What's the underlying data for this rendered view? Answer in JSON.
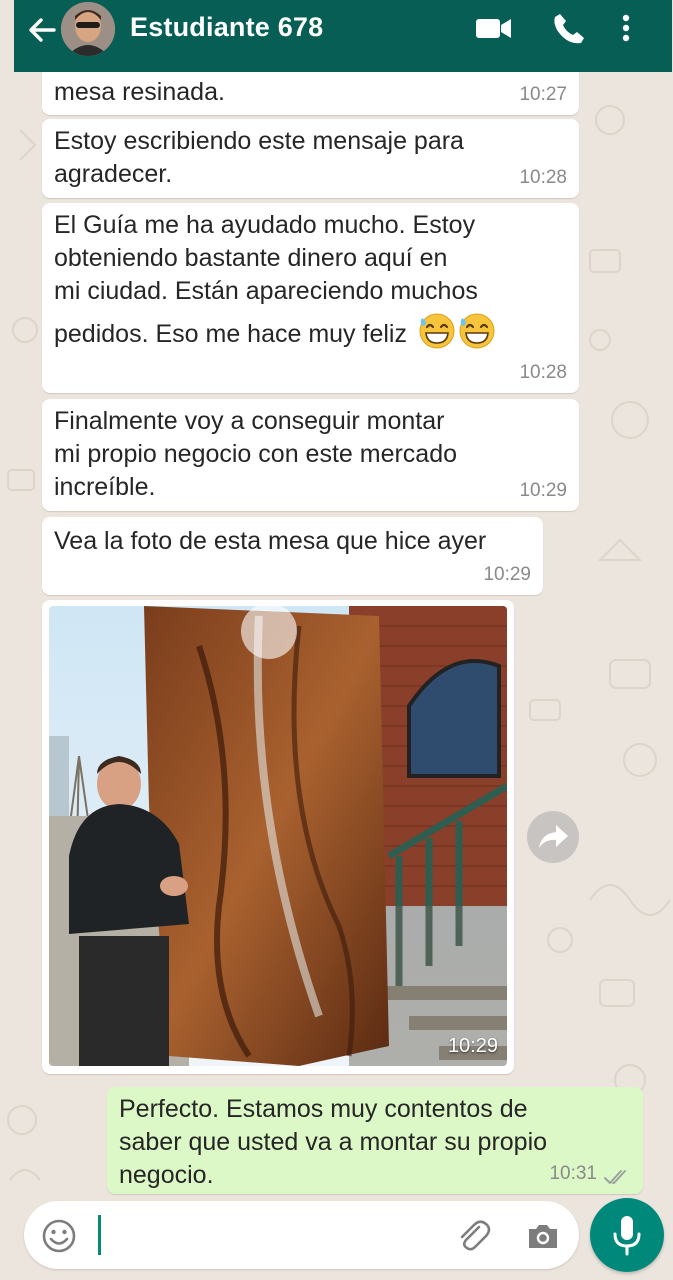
{
  "header": {
    "contact_name": "Estudiante 678",
    "icons": [
      "back-arrow-icon",
      "avatar",
      "video-call-icon",
      "phone-icon",
      "more-vert-icon"
    ]
  },
  "messages": [
    {
      "text": "mesa resinada.",
      "time": "10:27"
    },
    {
      "text": "Estoy escribiendo este mensaje para\nagradecer.",
      "time": "10:28"
    },
    {
      "lines": [
        "El Guía me ha ayudado mucho. Estoy",
        "obteniendo bastante dinero aquí en",
        "mi ciudad. Están apareciendo muchos",
        "pedidos. Eso me hace muy feliz"
      ],
      "emoji": [
        "grinning-sweat-emoji",
        "grinning-sweat-emoji"
      ],
      "time": "10:28"
    },
    {
      "text": "Finalmente voy a conseguir montar\nmi propio negocio con este mercado\nincreíble.",
      "time": "10:29"
    },
    {
      "text": "Vea la foto de esta mesa que hice ayer",
      "time": "10:29"
    },
    {
      "type": "image",
      "time": "10:29"
    },
    {
      "text": "Perfecto. Estamos muy contentos de\nsaber que usted va a montar su propio\nnegocio.",
      "time": "10:31",
      "status": "read-double-check-icon"
    }
  ],
  "input": {
    "icons": [
      "emoji-icon",
      "attach-icon",
      "camera-icon",
      "mic-icon"
    ]
  },
  "colors": {
    "header": "#075e54",
    "outgoing": "#dcf8c6",
    "incoming": "#ffffff",
    "accent": "#00897b",
    "background": "#ece5dd"
  }
}
